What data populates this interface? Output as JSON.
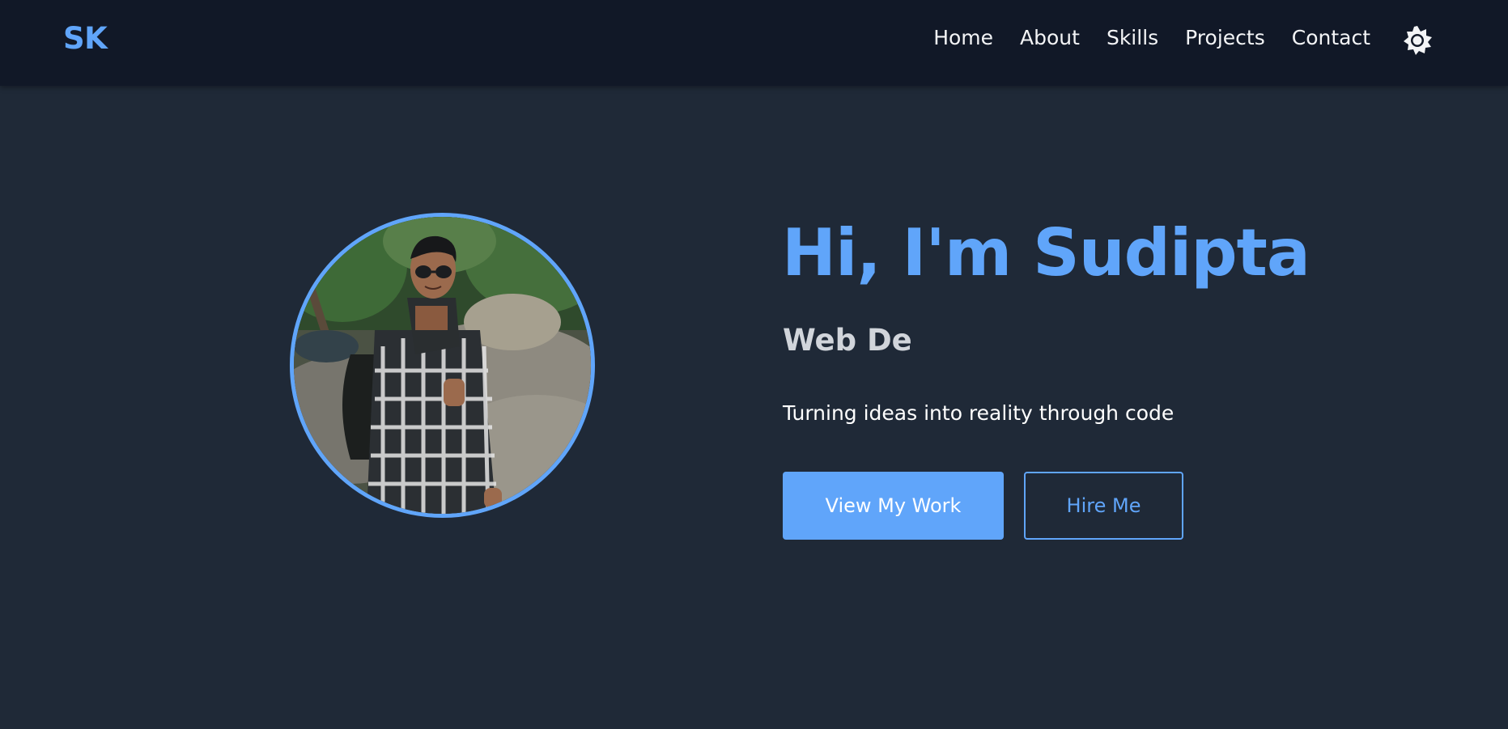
{
  "navbar": {
    "logo": "SK",
    "links": [
      "Home",
      "About",
      "Skills",
      "Projects",
      "Contact"
    ],
    "theme_toggle_icon": "sun-icon"
  },
  "hero": {
    "title": "Hi, I'm Sudipta",
    "subtitle": "Web De",
    "tagline": "Turning ideas into reality through code",
    "primary_button": "View My Work",
    "secondary_button": "Hire Me",
    "avatar_icon": "profile-photo"
  },
  "colors": {
    "accent": "#60a5fa",
    "navbar_bg": "#111827",
    "page_bg": "#1f2937",
    "subtitle": "#d1d5db",
    "text": "#ffffff"
  }
}
